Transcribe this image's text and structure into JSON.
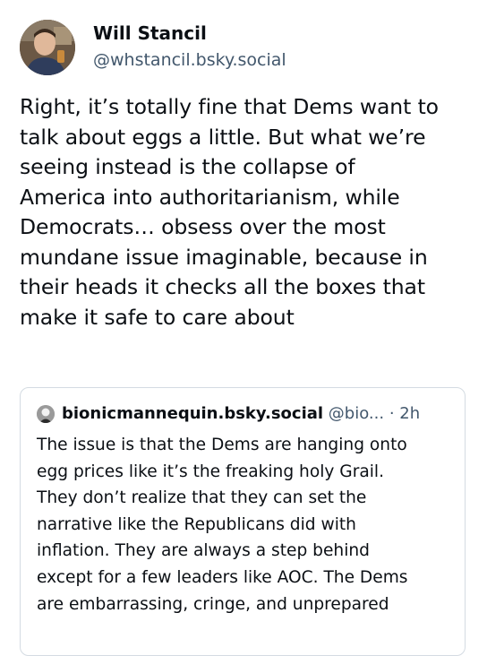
{
  "post": {
    "author": {
      "display_name": "Will Stancil",
      "handle": "@whstancil.bsky.social",
      "avatar_icon": "user-avatar"
    },
    "text": "Right, it’s totally fine that Dems want to\ntalk about eggs a little. But what we’re\nseeing instead is the collapse of\nAmerica into authoritarianism, while\nDemocrats… obsess over the most\nmundane issue imaginable, because in\ntheir heads it checks all the boxes that\nmake it safe to care about"
  },
  "quote": {
    "author_name": "bionicmannequin.bsky.social",
    "author_handle": "@bio...",
    "separator": "·",
    "time": "2h",
    "avatar_icon": "quoted-user-avatar",
    "text": "The issue is that the Dems are hanging onto\negg prices like it’s the freaking holy Grail.\nThey don’t realize that they can set the\nnarrative like the Republicans did with\ninflation. They are always a step behind\nexcept for a few leaders like AOC. The Dems\nare embarrassing, cringe, and unprepared"
  },
  "colors": {
    "text": "#0b0f14",
    "secondary": "#42576c",
    "card_border": "#d4dbe2",
    "background": "#ffffff"
  }
}
